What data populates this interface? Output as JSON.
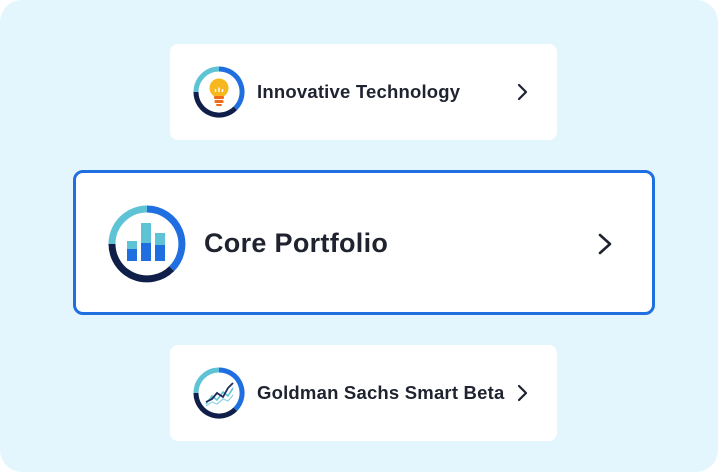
{
  "cards": [
    {
      "label": "Innovative Technology",
      "icon": "lightbulb-icon",
      "selected": false
    },
    {
      "label": "Core Portfolio",
      "icon": "bar-chart-icon",
      "selected": true
    },
    {
      "label": "Goldman Sachs Smart Beta",
      "icon": "line-chart-icon",
      "selected": false
    }
  ],
  "colors": {
    "background": "#e3f5fd",
    "card": "#ffffff",
    "selected_border": "#1f6fe0",
    "ring_teal": "#5fc3d6",
    "ring_blue": "#1f6fe0",
    "ring_navy": "#0f1f4a",
    "text": "#1f2330"
  }
}
